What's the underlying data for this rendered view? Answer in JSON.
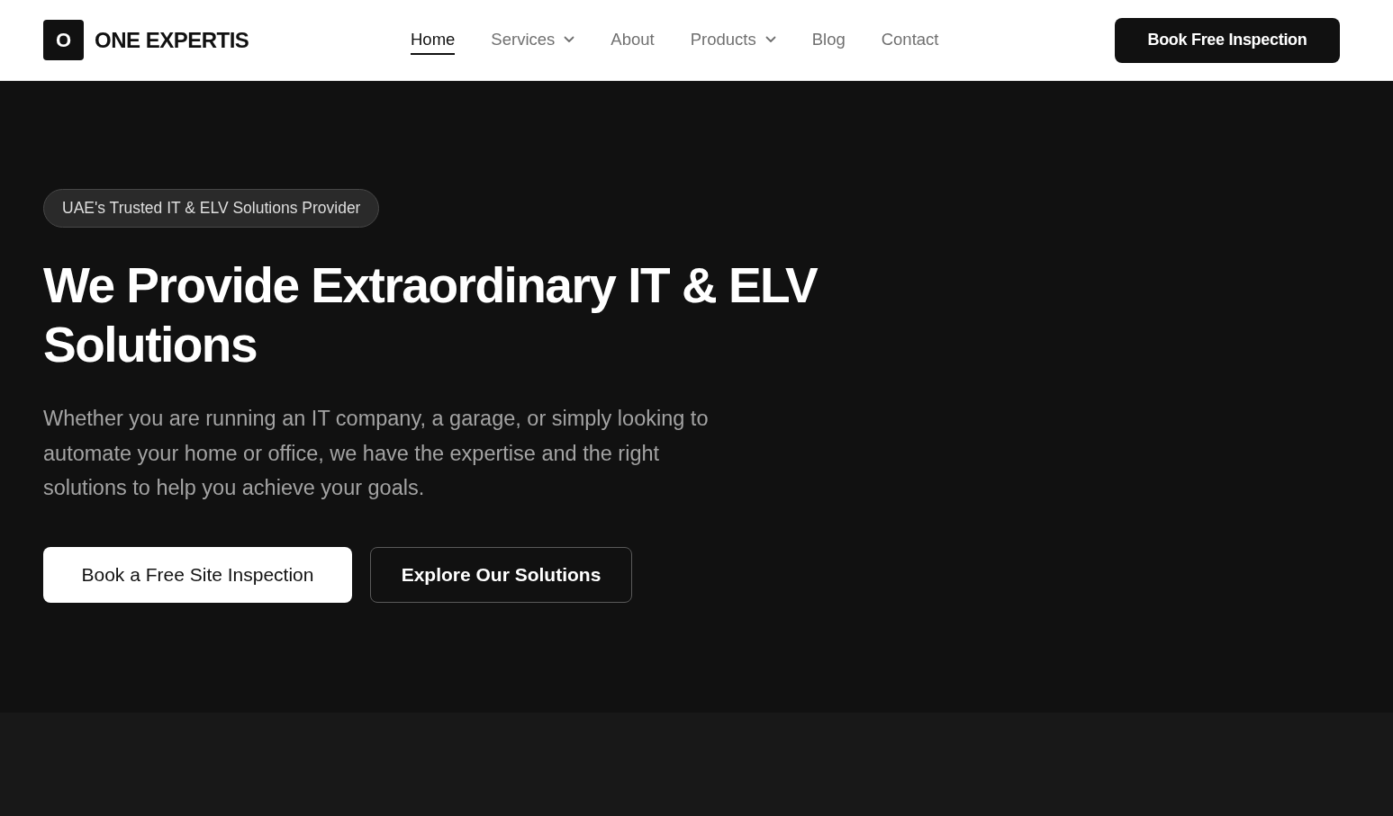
{
  "header": {
    "logo": {
      "mark": "O",
      "name": "ONE EXPERTIS"
    },
    "nav": [
      {
        "label": "Home",
        "selected": true,
        "dropdown": false
      },
      {
        "label": "Services",
        "selected": false,
        "dropdown": true
      },
      {
        "label": "About",
        "selected": false,
        "dropdown": false
      },
      {
        "label": "Products",
        "selected": false,
        "dropdown": true
      },
      {
        "label": "Blog",
        "selected": false,
        "dropdown": false
      },
      {
        "label": "Contact",
        "selected": false,
        "dropdown": false
      }
    ],
    "cta": "Book Free Inspection"
  },
  "hero": {
    "badge": "UAE's Trusted IT & ELV Solutions Provider",
    "title": "We Provide Extraordinary IT & ELV Solutions",
    "text": "Whether you are running an IT company, a garage, or simply looking to automate your home or office, we have the expertise and the right solutions to help you achieve your goals.",
    "buttons": [
      {
        "label": "Book a Free Site Inspection",
        "kind": "primary"
      },
      {
        "label": "Explore Our Solutions",
        "kind": "secondary"
      }
    ]
  }
}
